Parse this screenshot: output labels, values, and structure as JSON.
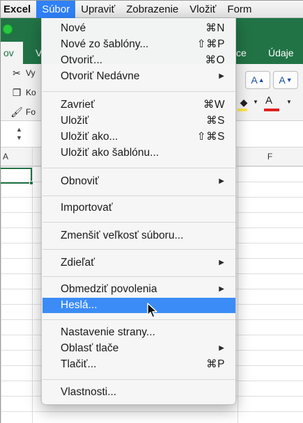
{
  "menubar": {
    "app": "Excel",
    "items": [
      "Súbor",
      "Upraviť",
      "Zobrazenie",
      "Vložiť",
      "Form"
    ]
  },
  "ribbon": {
    "active_tab": "ov",
    "tab_v": "V",
    "tab_ce": "ce",
    "tab_udaje": "Údaje",
    "cut_label": "Vy",
    "copy_label": "Ko",
    "format_label": "Fo",
    "grow_font": "A",
    "shrink_font": "A",
    "font_color_letter": "A",
    "font_color": "#e02020",
    "fill_color": "#ffe94d"
  },
  "grid": {
    "col_left": "A",
    "col_right": "F"
  },
  "file_menu": {
    "items": [
      {
        "label": "Nové",
        "shortcut": "⌘N"
      },
      {
        "label": "Nové zo šablóny...",
        "shortcut": "⇧⌘P"
      },
      {
        "label": "Otvoriť...",
        "shortcut": "⌘O"
      },
      {
        "label": "Otvoriť Nedávne",
        "submenu": "▶"
      },
      {
        "label": "Zavrieť",
        "shortcut": "⌘W"
      },
      {
        "label": "Uložiť",
        "shortcut": "⌘S"
      },
      {
        "label": "Uložiť ako...",
        "shortcut": "⇧⌘S"
      },
      {
        "label": "Uložiť ako šablónu..."
      },
      {
        "label": "Obnoviť",
        "submenu": "▶"
      },
      {
        "label": "Importovať"
      },
      {
        "label": "Zmenšiť veľkosť súboru..."
      },
      {
        "label": "Zdieľať",
        "submenu": "▶"
      },
      {
        "label": "Obmedziť povolenia",
        "submenu": "▶"
      },
      {
        "label": "Heslá..."
      },
      {
        "label": "Nastavenie strany..."
      },
      {
        "label": "Oblasť tlače",
        "submenu": "▶"
      },
      {
        "label": "Tlačiť...",
        "shortcut": "⌘P"
      },
      {
        "label": "Vlastnosti..."
      }
    ]
  },
  "colors": {
    "excel_green": "#217346",
    "menu_highlight": "#3b8cf7"
  }
}
